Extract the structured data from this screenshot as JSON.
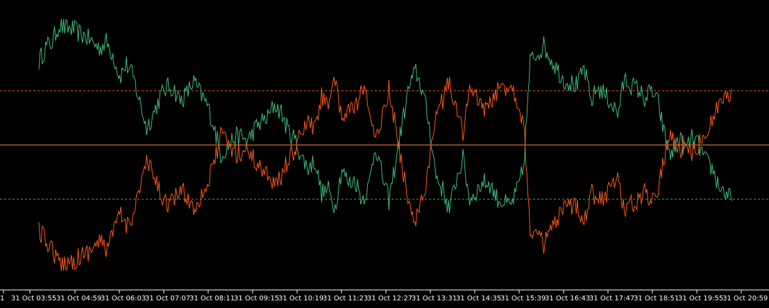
{
  "chart_data": {
    "type": "line",
    "x_tick_labels": [
      "1",
      "31 Oct 03:55",
      "31 Oct 04:59",
      "31 Oct 06:03",
      "31 Oct 07:07",
      "31 Oct 08:11",
      "31 Oct 09:15",
      "31 Oct 10:19",
      "31 Oct 11:23",
      "31 Oct 12:27",
      "31 Oct 13:31",
      "31 Oct 14:35",
      "31 Oct 15:39",
      "31 Oct 16:43",
      "31 Oct 17:47",
      "31 Oct 18:51",
      "31 Oct 19:55",
      "31 Oct 20:59"
    ],
    "ylim": [
      -180,
      180
    ],
    "grid": false,
    "levels": [
      {
        "value": 70,
        "color": "#ff5a1a",
        "style": "dashed"
      },
      {
        "value": 0,
        "color": "#ff8c3a",
        "style": "solid"
      },
      {
        "value": -70,
        "color": "#2fb36b",
        "style": "dashed"
      }
    ],
    "x_start": "31 Oct 03:55",
    "x_end": "31 Oct 21:05",
    "x_end_fraction": 1.0,
    "series": [
      {
        "color": "#3fbf7a",
        "values": [
          108,
          126,
          133,
          155,
          150,
          150,
          144,
          140,
          132,
          125,
          133,
          117,
          88,
          104,
          88,
          55,
          22,
          40,
          62,
          75,
          73,
          57,
          67,
          82,
          66,
          52,
          25,
          -12,
          -4,
          10,
          11,
          5,
          20,
          30,
          35,
          52,
          42,
          19,
          8,
          -15,
          -30,
          -20,
          -62,
          -58,
          -80,
          -30,
          -50,
          -45,
          -70,
          -54,
          0,
          -40,
          -72,
          -22,
          30,
          75,
          95,
          70,
          25,
          -40,
          -58,
          -84,
          -44,
          -18,
          -70,
          -60,
          -48,
          -50,
          -68,
          -74,
          -80,
          -60,
          -30,
          108,
          118,
          128,
          112,
          98,
          84,
          80,
          76,
          100,
          56,
          74,
          66,
          55,
          40,
          85,
          77,
          72,
          60,
          70,
          54,
          10,
          -15,
          10,
          -5,
          8,
          0,
          -20,
          -30,
          -52,
          -62,
          -72
        ]
      },
      {
        "color": "#ff5a1a",
        "values": [
          -110,
          -124,
          -133,
          -155,
          -150,
          -150,
          -144,
          -140,
          -132,
          -125,
          -133,
          -117,
          -88,
          -104,
          -88,
          -55,
          -22,
          -40,
          -62,
          -75,
          -73,
          -57,
          -67,
          -82,
          -66,
          -52,
          -25,
          12,
          4,
          -10,
          -11,
          -5,
          -20,
          -30,
          -35,
          -52,
          -42,
          -19,
          -8,
          15,
          30,
          20,
          62,
          58,
          80,
          30,
          50,
          45,
          70,
          54,
          0,
          40,
          72,
          22,
          -30,
          -75,
          -95,
          -70,
          -25,
          40,
          58,
          84,
          44,
          18,
          70,
          60,
          48,
          50,
          68,
          74,
          80,
          60,
          30,
          -108,
          -118,
          -128,
          -112,
          -98,
          -84,
          -80,
          -76,
          -100,
          -56,
          -74,
          -66,
          -55,
          -40,
          -85,
          -77,
          -72,
          -60,
          -70,
          -54,
          -10,
          15,
          -10,
          5,
          -8,
          0,
          20,
          30,
          52,
          62,
          72
        ]
      }
    ]
  }
}
